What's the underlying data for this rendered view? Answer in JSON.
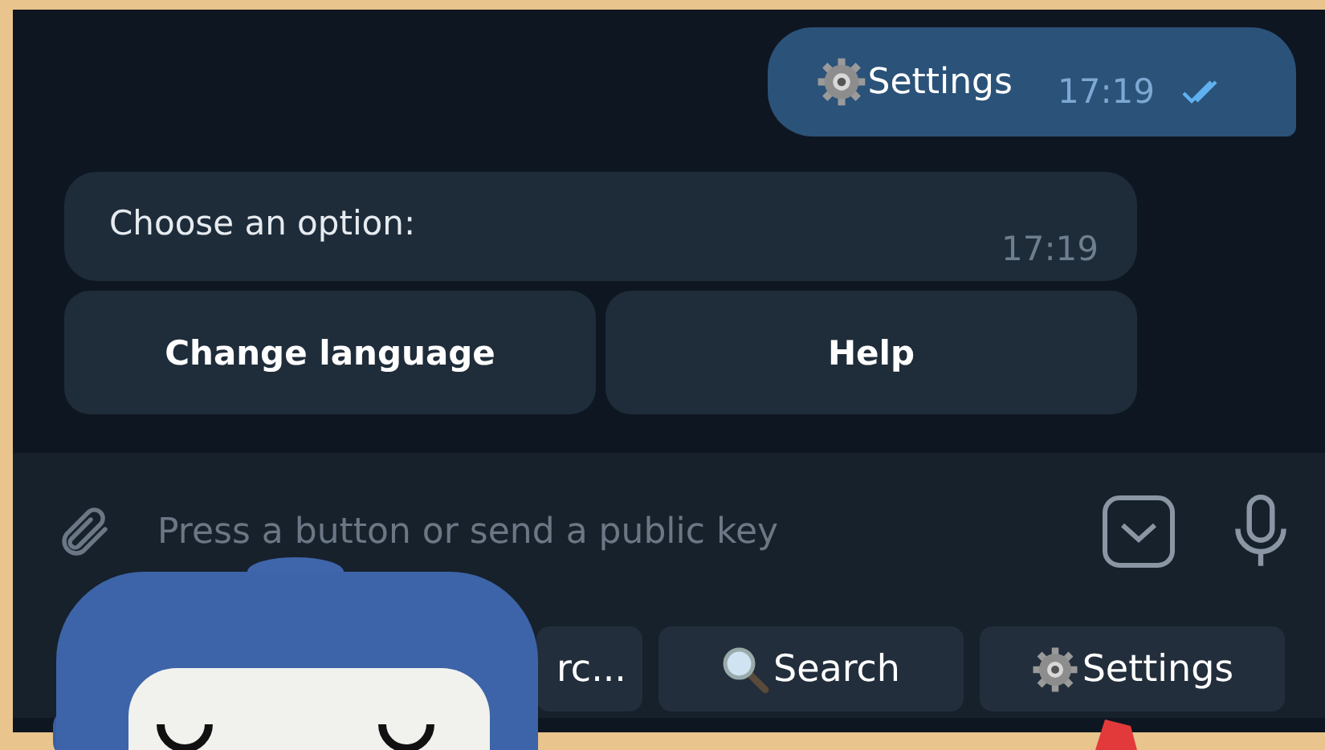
{
  "messages": [
    {
      "kind": "outgoing",
      "text": "Settings",
      "time": "17:19",
      "read": true
    },
    {
      "kind": "incoming",
      "text": "Choose an option:",
      "time": "17:19"
    }
  ],
  "inline_buttons": [
    "Change language",
    "Help"
  ],
  "composer": {
    "placeholder": "Press a button or send a public key"
  },
  "keyboard": [
    {
      "kind": "text",
      "label": "rc..."
    },
    {
      "kind": "search",
      "label": "Search"
    },
    {
      "kind": "settings",
      "label": "Settings"
    }
  ]
}
